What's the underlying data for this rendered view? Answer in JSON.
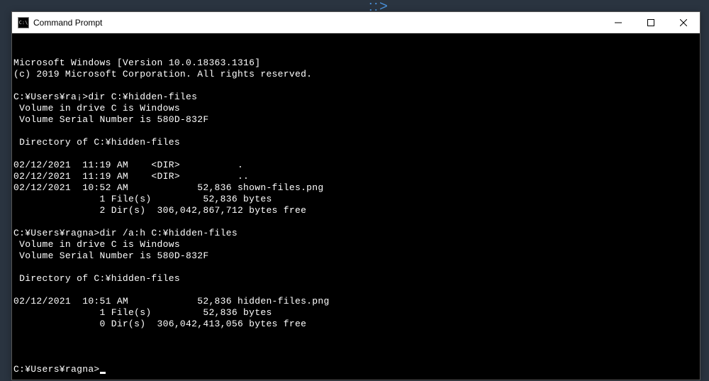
{
  "window": {
    "title": "Command Prompt",
    "icon_label": "C:\\"
  },
  "terminal": {
    "lines": [
      "Microsoft Windows [Version 10.0.18363.1316]",
      "(c) 2019 Microsoft Corporation. All rights reserved.",
      "",
      "C:¥Users¥ra¡>dir C:¥hidden-files",
      " Volume in drive C is Windows",
      " Volume Serial Number is 580D-832F",
      "",
      " Directory of C:¥hidden-files",
      "",
      "02/12/2021  11:19 AM    <DIR>          .",
      "02/12/2021  11:19 AM    <DIR>          ..",
      "02/12/2021  10:52 AM            52,836 shown-files.png",
      "               1 File(s)         52,836 bytes",
      "               2 Dir(s)  306,042,867,712 bytes free",
      "",
      "C:¥Users¥ragna>dir /a:h C:¥hidden-files",
      " Volume in drive C is Windows",
      " Volume Serial Number is 580D-832F",
      "",
      " Directory of C:¥hidden-files",
      "",
      "02/12/2021  10:51 AM            52,836 hidden-files.png",
      "               1 File(s)         52,836 bytes",
      "               0 Dir(s)  306,042,413,056 bytes free",
      ""
    ],
    "prompt": "C:¥Users¥ragna>"
  },
  "bg_decoration": "::>"
}
